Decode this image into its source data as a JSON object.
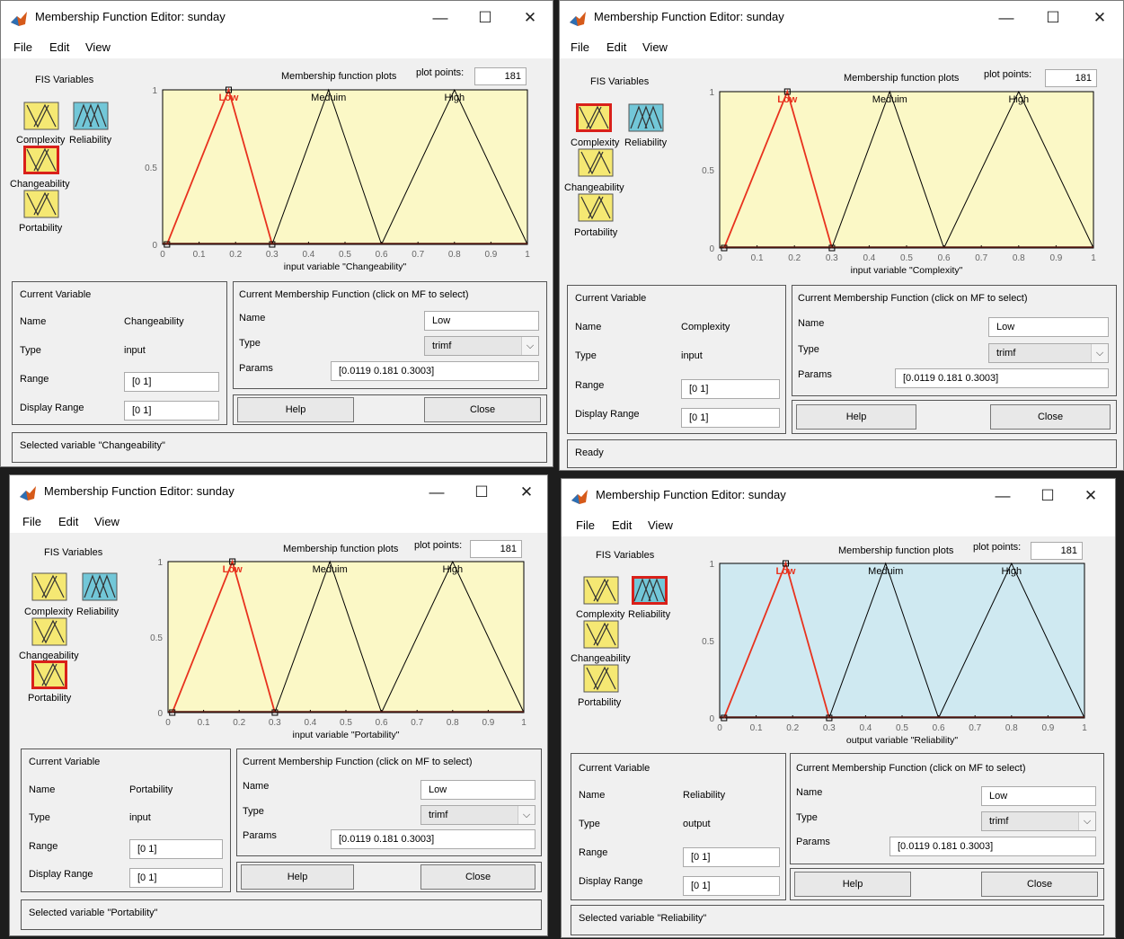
{
  "windows": [
    {
      "title": "Membership Function Editor: sunday",
      "menu": [
        "File",
        "Edit",
        "View"
      ],
      "fis_label": "FIS Variables",
      "var_labels": [
        "Complexity",
        "Reliability",
        "Changeability",
        "Portability"
      ],
      "selected_var": 2,
      "plot_title": "Membership function plots",
      "plot_points_label": "plot points:",
      "plot_points": "181",
      "mf_names": [
        "Low",
        "Meduim",
        "High"
      ],
      "x_ticks": [
        "0",
        "0.1",
        "0.2",
        "0.3",
        "0.4",
        "0.5",
        "0.6",
        "0.7",
        "0.8",
        "0.9",
        "1"
      ],
      "y_ticks": [
        "0",
        "0.5",
        "1"
      ],
      "xlabel": "input variable \"Changeability\"",
      "current_variable_title": "Current Variable",
      "name_label": "Name",
      "name_value": "Changeability",
      "type_label": "Type",
      "type_value": "input",
      "range_label": "Range",
      "range_value": "[0 1]",
      "display_range_label": "Display Range",
      "display_range_value": "[0 1]",
      "mf_panel_title": "Current Membership Function (click on MF to select)",
      "mf_name_label": "Name",
      "mf_name_value": "Low",
      "mf_type_label": "Type",
      "mf_type_value": "trimf",
      "params_label": "Params",
      "params_value": "[0.0119 0.181 0.3003]",
      "help_label": "Help",
      "close_label": "Close",
      "status": "Selected variable \"Changeability\"",
      "plot_bg": "#fbf8c6"
    },
    {
      "title": "Membership Function Editor: sunday",
      "menu": [
        "File",
        "Edit",
        "View"
      ],
      "fis_label": "FIS Variables",
      "var_labels": [
        "Complexity",
        "Reliability",
        "Changeability",
        "Portability"
      ],
      "selected_var": 0,
      "plot_title": "Membership function plots",
      "plot_points_label": "plot points:",
      "plot_points": "181",
      "mf_names": [
        "Low",
        "Meduim",
        "High"
      ],
      "x_ticks": [
        "0",
        "0.1",
        "0.2",
        "0.3",
        "0.4",
        "0.5",
        "0.6",
        "0.7",
        "0.8",
        "0.9",
        "1"
      ],
      "y_ticks": [
        "0",
        "0.5",
        "1"
      ],
      "xlabel": "input variable \"Complexity\"",
      "current_variable_title": "Current Variable",
      "name_label": "Name",
      "name_value": "Complexity",
      "type_label": "Type",
      "type_value": "input",
      "range_label": "Range",
      "range_value": "[0 1]",
      "display_range_label": "Display Range",
      "display_range_value": "[0 1]",
      "mf_panel_title": "Current Membership Function (click on MF to select)",
      "mf_name_label": "Name",
      "mf_name_value": "Low",
      "mf_type_label": "Type",
      "mf_type_value": "trimf",
      "params_label": "Params",
      "params_value": "[0.0119 0.181 0.3003]",
      "help_label": "Help",
      "close_label": "Close",
      "status": "Ready",
      "plot_bg": "#fbf8c6"
    },
    {
      "title": "Membership Function Editor: sunday",
      "menu": [
        "File",
        "Edit",
        "View"
      ],
      "fis_label": "FIS Variables",
      "var_labels": [
        "Complexity",
        "Reliability",
        "Changeability",
        "Portability"
      ],
      "selected_var": 3,
      "plot_title": "Membership function plots",
      "plot_points_label": "plot points:",
      "plot_points": "181",
      "mf_names": [
        "Low",
        "Meduim",
        "High"
      ],
      "x_ticks": [
        "0",
        "0.1",
        "0.2",
        "0.3",
        "0.4",
        "0.5",
        "0.6",
        "0.7",
        "0.8",
        "0.9",
        "1"
      ],
      "y_ticks": [
        "0",
        "0.5",
        "1"
      ],
      "xlabel": "input variable \"Portability\"",
      "current_variable_title": "Current Variable",
      "name_label": "Name",
      "name_value": "Portability",
      "type_label": "Type",
      "type_value": "input",
      "range_label": "Range",
      "range_value": "[0 1]",
      "display_range_label": "Display Range",
      "display_range_value": "[0 1]",
      "mf_panel_title": "Current Membership Function (click on MF to select)",
      "mf_name_label": "Name",
      "mf_name_value": "Low",
      "mf_type_label": "Type",
      "mf_type_value": "trimf",
      "params_label": "Params",
      "params_value": "[0.0119 0.181 0.3003]",
      "help_label": "Help",
      "close_label": "Close",
      "status": "Selected variable \"Portability\"",
      "plot_bg": "#fbf8c6"
    },
    {
      "title": "Membership Function Editor: sunday",
      "menu": [
        "File",
        "Edit",
        "View"
      ],
      "fis_label": "FIS Variables",
      "var_labels": [
        "Complexity",
        "Reliability",
        "Changeability",
        "Portability"
      ],
      "selected_var": 1,
      "plot_title": "Membership function plots",
      "plot_points_label": "plot points:",
      "plot_points": "181",
      "mf_names": [
        "Low",
        "Meduim",
        "High"
      ],
      "x_ticks": [
        "0",
        "0.1",
        "0.2",
        "0.3",
        "0.4",
        "0.5",
        "0.6",
        "0.7",
        "0.8",
        "0.9",
        "1"
      ],
      "y_ticks": [
        "0",
        "0.5",
        "1"
      ],
      "xlabel": "output variable \"Reliability\"",
      "current_variable_title": "Current Variable",
      "name_label": "Name",
      "name_value": "Reliability",
      "type_label": "Type",
      "type_value": "output",
      "range_label": "Range",
      "range_value": "[0 1]",
      "display_range_label": "Display Range",
      "display_range_value": "[0 1]",
      "mf_panel_title": "Current Membership Function (click on MF to select)",
      "mf_name_label": "Name",
      "mf_name_value": "Low",
      "mf_type_label": "Type",
      "mf_type_value": "trimf",
      "params_label": "Params",
      "params_value": "[0.0119 0.181 0.3003]",
      "help_label": "Help",
      "close_label": "Close",
      "status": "Selected variable \"Reliability\"",
      "plot_bg": "#cfe9f1"
    }
  ],
  "mf_params": [
    [
      0.0119,
      0.181,
      0.3003
    ],
    [
      0.3,
      0.455,
      0.6
    ],
    [
      0.6,
      0.8,
      1.0
    ]
  ],
  "colors": {
    "selected_mf": "#e8321e",
    "mf_line": "#000000",
    "input_icon": "#f5e873",
    "output_icon": "#72c7d8",
    "selection_border": "#d9201a"
  }
}
